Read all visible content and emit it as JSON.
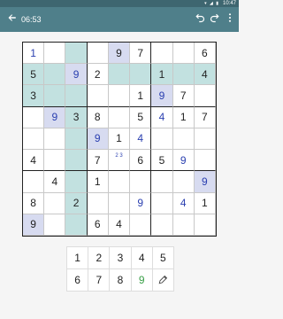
{
  "statusbar": {
    "time": "10:47",
    "icons": "▾ ◢ ▮"
  },
  "toolbar": {
    "timer": "06:53",
    "back_icon": "arrow-left-icon",
    "undo_icon": "undo-icon",
    "redo_icon": "redo-icon",
    "menu_icon": "more-vert-icon"
  },
  "board": {
    "rows": [
      [
        "1",
        "",
        "",
        "",
        "9",
        "7",
        "",
        "",
        "6"
      ],
      [
        "5",
        "",
        "9",
        "2",
        "",
        "",
        "1",
        "",
        "4"
      ],
      [
        "3",
        "",
        "",
        "",
        "",
        "1",
        "9",
        "7",
        ""
      ],
      [
        "",
        "9",
        "3",
        "8",
        "",
        "5",
        "4",
        "1",
        "7"
      ],
      [
        "",
        "",
        "",
        "9",
        "1",
        "4",
        "",
        "",
        ""
      ],
      [
        "4",
        "",
        "",
        "7",
        "2 3",
        "6",
        "5",
        "9",
        ""
      ],
      [
        "",
        "4",
        "",
        "1",
        "",
        "",
        "",
        "",
        "9"
      ],
      [
        "8",
        "",
        "2",
        "",
        "",
        "9",
        "",
        "4",
        "1"
      ],
      [
        "9",
        "",
        "",
        "6",
        "4",
        "",
        "",
        "",
        ""
      ]
    ]
  },
  "keypad": {
    "keys": [
      "1",
      "2",
      "3",
      "4",
      "5",
      "6",
      "7",
      "8",
      "9"
    ],
    "pencil_icon": "pencil-icon",
    "active_key": "9"
  },
  "colors": {
    "toolbar": "#4f7f8a",
    "highlight": "#c2e1e0",
    "same_number": "#d7dbf0",
    "user_digit": "#2a3fb0",
    "active_key": "#3aa048"
  }
}
